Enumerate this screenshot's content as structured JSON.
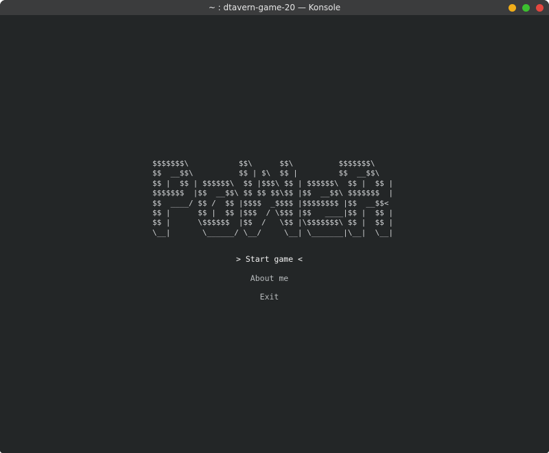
{
  "window": {
    "title": "~ : dtavern-game-20 — Konsole"
  },
  "logo_lines": [
    "$$$$$$$\\           $$\\      $$\\          $$$$$$$\\  ",
    "$$  __$$\\          $$ | $\\  $$ |         $$  __$$\\ ",
    "$$ |  $$ | $$$$$$\\  $$ |$$$\\ $$ | $$$$$$\\  $$ |  $$ |",
    "$$$$$$$  |$$  __$$\\ $$ $$ $$\\$$ |$$  __$$\\ $$$$$$$  |",
    "$$  ____/ $$ /  $$ |$$$$  _$$$$ |$$$$$$$$ |$$  __$$< ",
    "$$ |      $$ |  $$ |$$$  / \\$$$ |$$   ____|$$ |  $$ |",
    "$$ |      \\$$$$$$  |$$  /   \\$$ |\\$$$$$$$\\ $$ |  $$ |",
    "\\__|       \\______/ \\__/     \\__| \\_______|\\__|  \\__|"
  ],
  "menu": [
    {
      "label": "> Start game <",
      "selected": true
    },
    {
      "label": "About me",
      "selected": false
    },
    {
      "label": "Exit",
      "selected": false
    }
  ]
}
